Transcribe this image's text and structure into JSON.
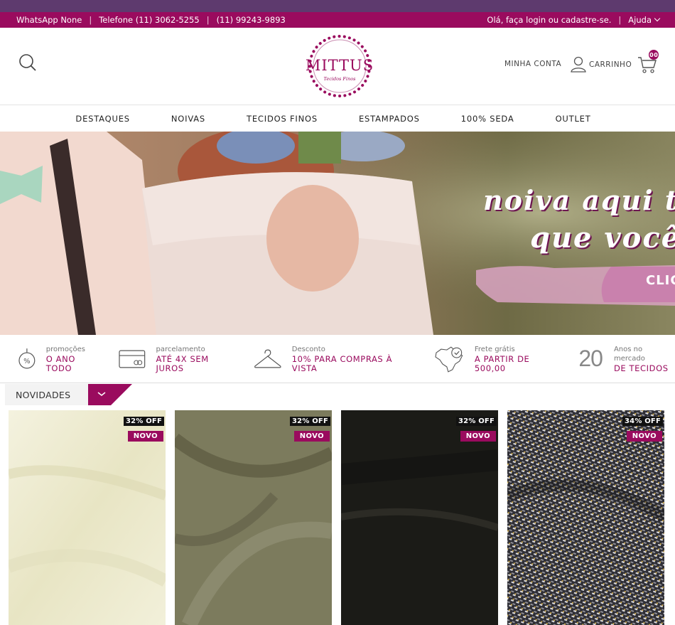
{
  "topbar": {
    "whatsapp": "WhatsApp None",
    "telefone": "Telefone (11) 3062-5255",
    "celular": "(11) 99243-9893",
    "login": "Olá, faça login ou cadastre-se.",
    "ajuda": "Ajuda"
  },
  "header": {
    "logo_name": "MITTUS",
    "logo_tagline": "Tecidos Finos",
    "account_label": "MINHA CONTA",
    "cart_label": "CARRINHO",
    "cart_count": "00"
  },
  "nav": [
    "DESTAQUES",
    "NOIVAS",
    "TECIDOS FINOS",
    "ESTAMPADOS",
    "100% SEDA",
    "OUTLET"
  ],
  "hero": {
    "line1": "noiva aqui t",
    "line2": "que você",
    "cta": "CLIC"
  },
  "features": [
    {
      "icon": "percent-icon",
      "small": "promoções",
      "big": "O ANO TODO"
    },
    {
      "icon": "credit-card-icon",
      "small": "parcelamento",
      "big": "ATÉ 4X SEM JUROS"
    },
    {
      "icon": "hanger-icon",
      "small": "Desconto",
      "big": "10% PARA COMPRAS À VISTA"
    },
    {
      "icon": "brazil-map-icon",
      "small": "Frete grátis",
      "big": "A PARTIR DE 500,00"
    },
    {
      "years": "20",
      "small": "Anos no mercado",
      "big": "DE TECIDOS"
    }
  ],
  "section": {
    "title": "NOVIDADES"
  },
  "products": [
    {
      "discount": "32% OFF",
      "tag": "NOVO",
      "color": "#efecd2"
    },
    {
      "discount": "32% OFF",
      "tag": "NOVO",
      "color": "#7d7c5e"
    },
    {
      "discount": "32% OFF",
      "tag": "NOVO",
      "color": "#1c1b17"
    },
    {
      "discount": "34% OFF",
      "tag": "NOVO",
      "color": "#3a3a40"
    }
  ],
  "colors": {
    "brand": "#9a0b5e",
    "top_accent": "#5e3a6e"
  }
}
